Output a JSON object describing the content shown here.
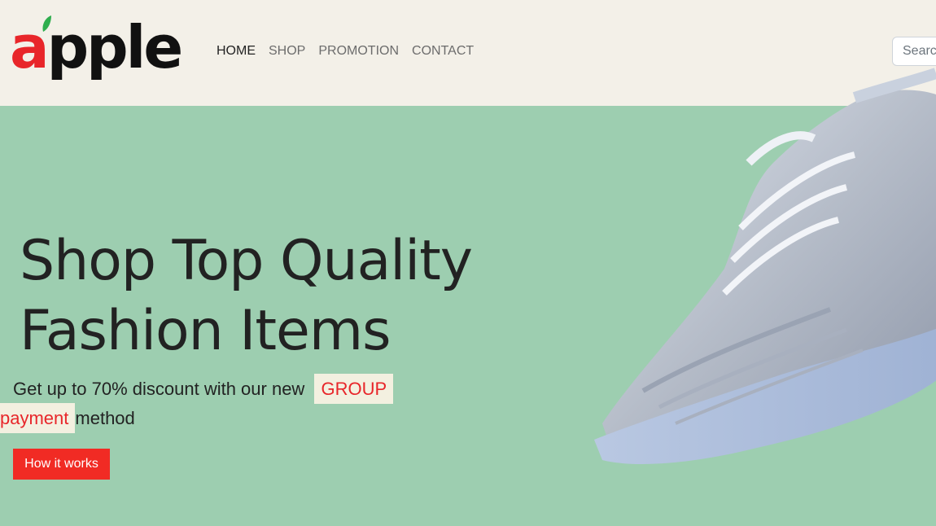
{
  "brand": {
    "logo_first": "a",
    "logo_rest": "pple"
  },
  "nav": {
    "items": [
      {
        "label": "HOME"
      },
      {
        "label": "SHOP"
      },
      {
        "label": "PROMOTION"
      },
      {
        "label": "CONTACT"
      }
    ]
  },
  "search": {
    "placeholder": "Search"
  },
  "hero": {
    "title_line1": "Shop Top Quality",
    "title_line2": "Fashion Items",
    "sub_before": "Get up to 70% discount with our new",
    "highlight1": "GROUP",
    "highlight2": "payment",
    "sub_after": "method",
    "cta_label": "How it works"
  },
  "colors": {
    "accent": "#f12b24",
    "hero_bg": "#9dceb0",
    "header_bg": "#f3f0e8",
    "highlight_bg": "#f3f0e0"
  },
  "icons": {
    "logo_leaf": "leaf-icon",
    "hero_image": "sneaker-image"
  }
}
